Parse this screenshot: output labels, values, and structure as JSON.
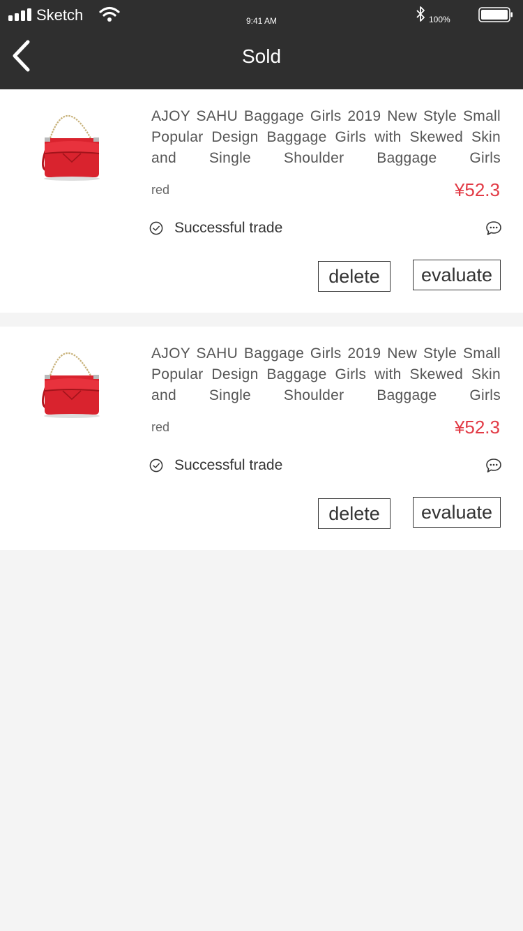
{
  "status_bar": {
    "carrier": "Sketch",
    "time": "9:41 AM",
    "battery": "100%"
  },
  "nav": {
    "title": "Sold",
    "back_icon": "chevron-left-icon"
  },
  "orders": [
    {
      "title": "AJOY SAHU Baggage Girls 2019 New Style Small Popular Design Baggage Girls with Skewed Skin and Single Shoulder Baggage Girls",
      "variant": "red",
      "price": "¥52.3",
      "status": "Successful trade",
      "delete_label": "delete",
      "evaluate_label": "evaluate"
    },
    {
      "title": "AJOY SAHU Baggage Girls 2019 New Style Small Popular Design Baggage Girls with Skewed Skin and Single Shoulder Baggage Girls",
      "variant": "red",
      "price": "¥52.3",
      "status": "Successful trade",
      "delete_label": "delete",
      "evaluate_label": "evaluate"
    }
  ],
  "icons": {
    "status": "check-circle-icon",
    "chat": "chat-bubble-icon"
  },
  "colors": {
    "header_bg": "#2f2f2f",
    "price": "#e23a45",
    "page_bg": "#f4f4f4",
    "product_red": "#d9232e"
  }
}
